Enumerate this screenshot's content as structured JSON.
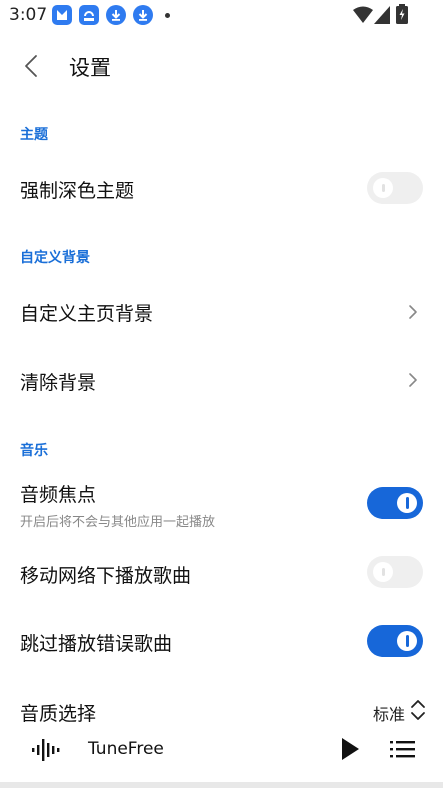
{
  "status_bar": {
    "time": "3:07"
  },
  "header": {
    "title": "设置"
  },
  "sections": {
    "theme": {
      "title": "主题",
      "force_dark": {
        "label": "强制深色主题",
        "enabled": false
      }
    },
    "background": {
      "title": "自定义背景",
      "custom_home_bg": {
        "label": "自定义主页背景"
      },
      "clear_bg": {
        "label": "清除背景"
      }
    },
    "music": {
      "title": "音乐",
      "audio_focus": {
        "label": "音频焦点",
        "subtitle": "开启后将不会与其他应用一起播放",
        "enabled": true
      },
      "mobile_network": {
        "label": "移动网络下播放歌曲",
        "enabled": false
      },
      "skip_errors": {
        "label": "跳过播放错误歌曲",
        "enabled": true
      },
      "quality": {
        "label": "音质选择",
        "value": "标准"
      }
    }
  },
  "player": {
    "title": "TuneFree"
  },
  "colors": {
    "accent": "#1767d9",
    "section_title": "#1a6fd8"
  }
}
